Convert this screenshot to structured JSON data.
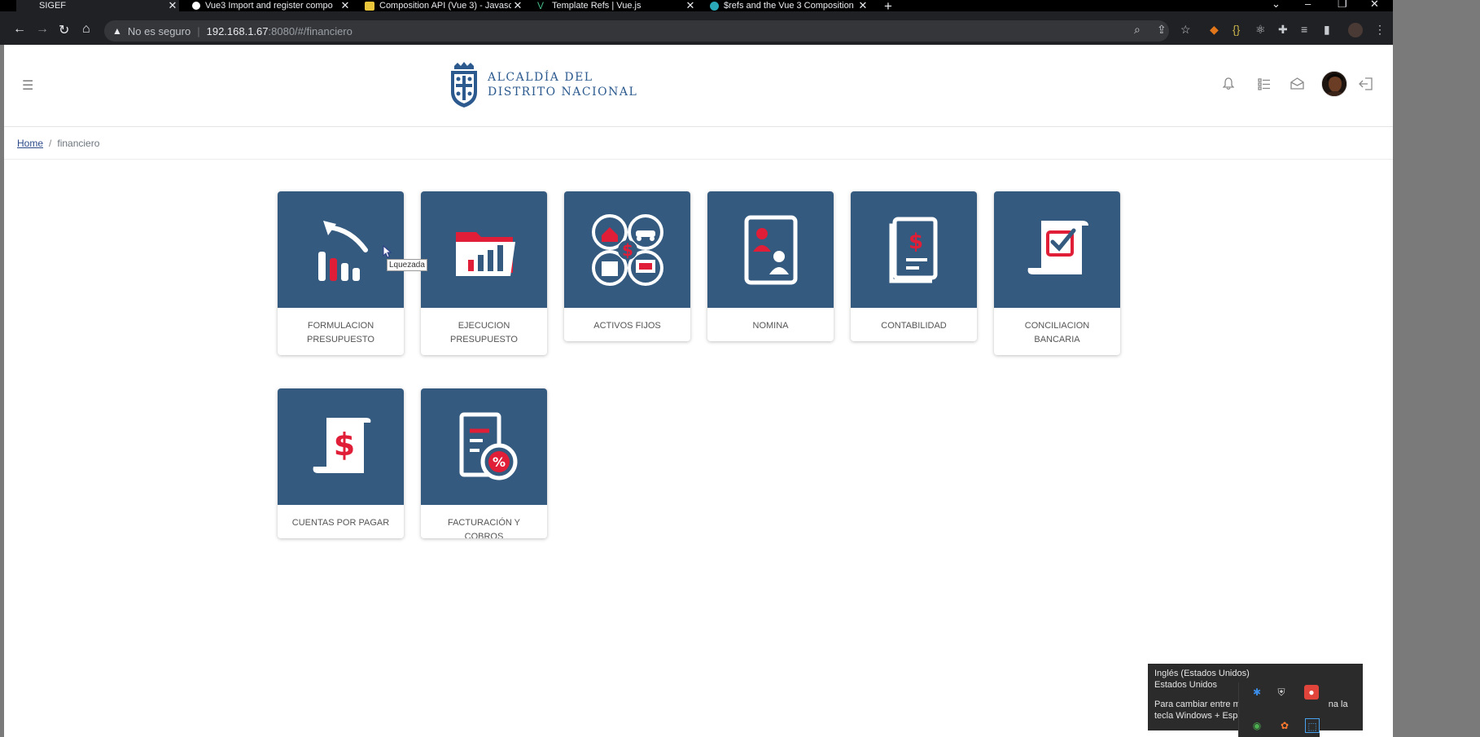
{
  "browser": {
    "tabs": [
      {
        "title": "SIGEF",
        "favicon": "sigef-icon",
        "active": true
      },
      {
        "title": "Vue3 Import and register compo",
        "favicon": "medium-icon"
      },
      {
        "title": "Composition API (Vue 3) - Javasc",
        "favicon": "js-icon"
      },
      {
        "title": "Template Refs | Vue.js",
        "favicon": "vue-icon"
      },
      {
        "title": "$refs and the Vue 3 Composition",
        "favicon": "vueschool-icon"
      }
    ],
    "address": {
      "security_label": "No es seguro",
      "host": "192.168.1.67",
      "rest": ":8080/#/financiero"
    }
  },
  "header": {
    "logo_line1": "ALCALDÍA DEL",
    "logo_line2": "DISTRITO NACIONAL"
  },
  "breadcrumb": {
    "home": "Home",
    "current": "financiero"
  },
  "tooltip": "Lquezada",
  "modules": [
    {
      "label": "FORMULACION PRESUPUESTO",
      "icon": "chart-up-icon"
    },
    {
      "label": "EJECUCION PRESUPUESTO",
      "icon": "folder-chart-icon"
    },
    {
      "label": "ACTIVOS FIJOS",
      "icon": "assets-icon"
    },
    {
      "label": "NOMINA",
      "icon": "payroll-icon"
    },
    {
      "label": "CONTABILIDAD",
      "icon": "ledger-icon"
    },
    {
      "label": "CONCILIACION BANCARIA",
      "icon": "reconcile-icon"
    },
    {
      "label": "CUENTAS POR PAGAR",
      "icon": "payable-icon"
    },
    {
      "label": "FACTURACIÓN Y COBROS",
      "icon": "invoice-icon"
    }
  ],
  "ime": {
    "line1": "Inglés (Estados Unidos)",
    "line2": "Estados Unidos",
    "line3": "Para cambiar entre m",
    "line3_tail": "na la",
    "line4": "tecla Windows + Espa"
  },
  "colors": {
    "card_bg": "#345a7f",
    "accent_red": "#e01e37",
    "link": "#2c4a8a"
  }
}
